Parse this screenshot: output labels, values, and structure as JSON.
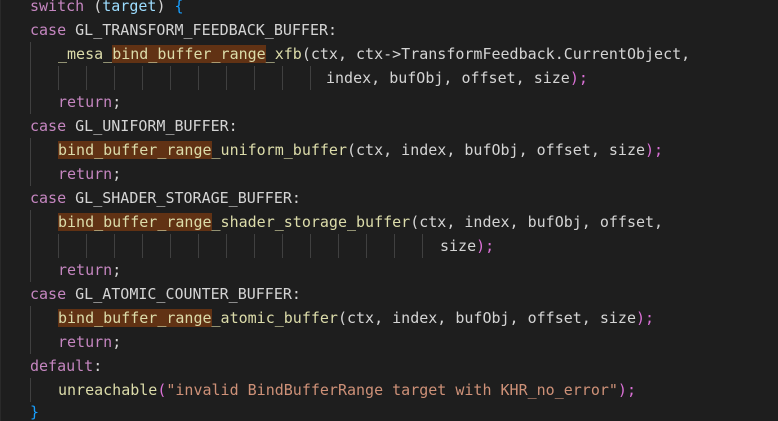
{
  "editor": {
    "lines": [
      {
        "t1": "switch",
        "t2": " (",
        "t3": "target",
        "t4": ") ",
        "t5": "{"
      },
      {
        "t1": "case",
        "t2": " GL_TRANSFORM_FEEDBACK_BUFFER:"
      },
      {
        "t1": "_mesa_",
        "t2": "bind_buffer_range",
        "t3": "_xfb",
        "t4": "(ctx, ctx->TransformFeedback.CurrentObject,"
      },
      {
        "t1": "index, bufObj, offset, size",
        "t2": ");"
      },
      {
        "t1": "return",
        "t2": ";"
      },
      {
        "t1": "case",
        "t2": " GL_UNIFORM_BUFFER:"
      },
      {
        "t1": "bind_buffer_range",
        "t2": "_uniform_buffer",
        "t3": "(ctx, index, bufObj, offset, size",
        "t4": ");"
      },
      {
        "t1": "return",
        "t2": ";"
      },
      {
        "t1": "case",
        "t2": " GL_SHADER_STORAGE_BUFFER:"
      },
      {
        "t1": "bind_buffer_range",
        "t2": "_shader_storage_buffer",
        "t3": "(ctx, index, bufObj, offset,"
      },
      {
        "t1": "size",
        "t2": ");"
      },
      {
        "t1": "return",
        "t2": ";"
      },
      {
        "t1": "case",
        "t2": " GL_ATOMIC_COUNTER_BUFFER:"
      },
      {
        "t1": "bind_buffer_range",
        "t2": "_atomic_buffer",
        "t3": "(ctx, index, bufObj, offset, size",
        "t4": ");"
      },
      {
        "t1": "return",
        "t2": ";"
      },
      {
        "t1": "default",
        "t2": ":"
      },
      {
        "t1": "unreachable",
        "t2": "(",
        "t3": "\"invalid BindBufferRange target with KHR_no_error\"",
        "t4": ");"
      },
      {
        "t1": "}"
      }
    ]
  },
  "colors": {
    "background": "#1e1e1e",
    "keyword": "#c586c0",
    "control": "#569cd6",
    "function": "#dcdcaa",
    "string": "#ce9178",
    "highlight": "#613214",
    "indent_guide": "#404040"
  }
}
